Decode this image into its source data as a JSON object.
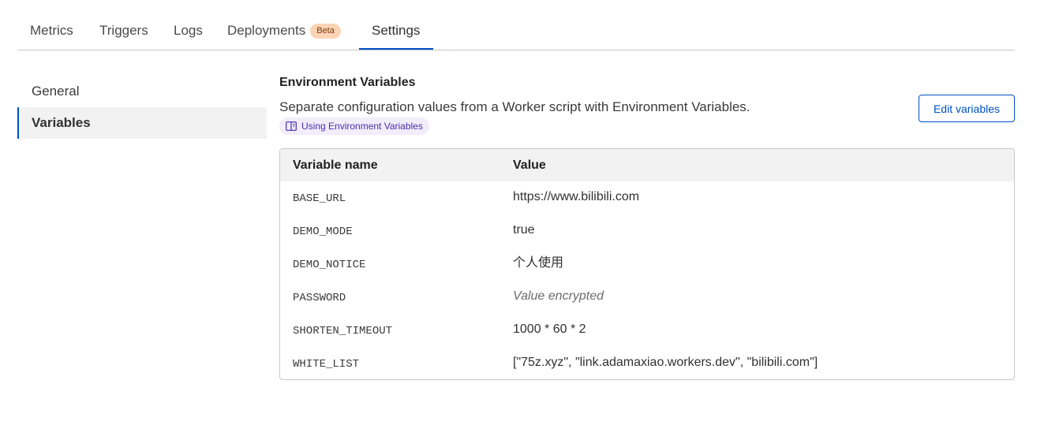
{
  "tabs": [
    {
      "label": "Metrics"
    },
    {
      "label": "Triggers"
    },
    {
      "label": "Logs"
    },
    {
      "label": "Deployments",
      "badge": "Beta"
    },
    {
      "label": "Settings",
      "active": true
    }
  ],
  "sidenav": {
    "items": [
      {
        "label": "General"
      },
      {
        "label": "Variables",
        "active": true
      }
    ]
  },
  "env": {
    "title": "Environment Variables",
    "description": "Separate configuration values from a Worker script with Environment Variables.",
    "doc_link": "Using Environment Variables",
    "edit_button": "Edit variables"
  },
  "table": {
    "headers": {
      "name": "Variable name",
      "value": "Value"
    },
    "rows": [
      {
        "name": "BASE_URL",
        "value": "https://www.bilibili.com"
      },
      {
        "name": "DEMO_MODE",
        "value": "true"
      },
      {
        "name": "DEMO_NOTICE",
        "value": "个人使用"
      },
      {
        "name": "PASSWORD",
        "value": "Value encrypted"
      },
      {
        "name": "SHORTEN_TIMEOUT",
        "value": "1000 * 60 * 2"
      },
      {
        "name": "WHITE_LIST",
        "value": "[\"75z.xyz\", \"link.adamaxiao.workers.dev\", \"bilibili.com\"]"
      }
    ]
  },
  "colors": {
    "accent": "#0051c3",
    "badge_bg": "#fbd4b5",
    "link_pill_bg": "#f1edfb"
  },
  "icons": {
    "doc_link": "book-icon"
  }
}
